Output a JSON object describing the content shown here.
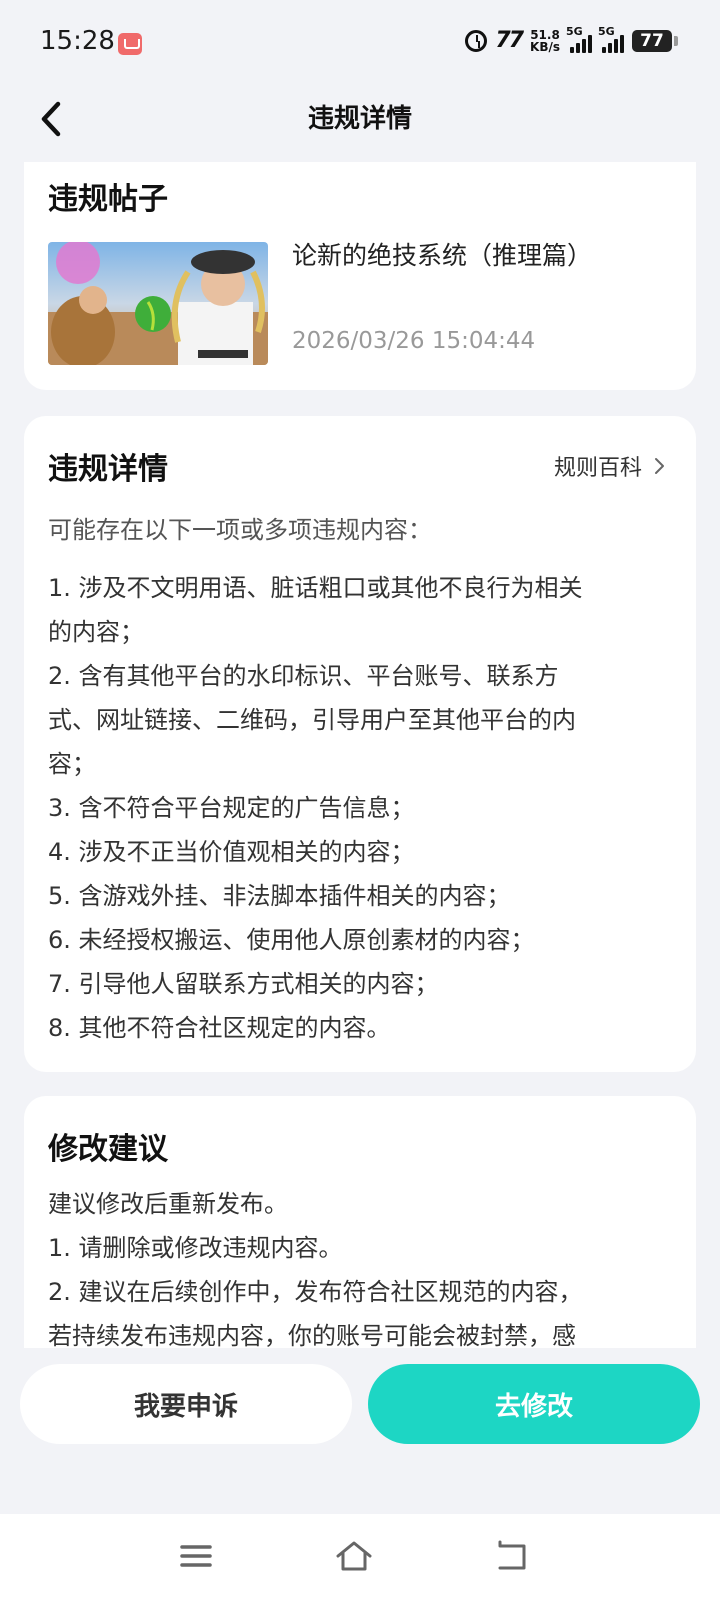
{
  "status_bar": {
    "time": "15:28",
    "net_speed_value": "51.8",
    "net_speed_unit": "KB/s",
    "signal1_label": "5G",
    "signal2_label": "5G",
    "battery": "77",
    "icons": [
      "shopping-app-icon",
      "alarm-icon",
      "nfc-icon",
      "signal-icon",
      "battery-icon"
    ]
  },
  "header": {
    "title": "违规详情"
  },
  "post_card": {
    "heading": "违规帖子",
    "post_title": "论新的绝技系统（推理篇）",
    "post_time": "2026/03/26 15:04:44"
  },
  "violation_card": {
    "heading": "违规详情",
    "rules_link": "规则百科",
    "intro": "可能存在以下一项或多项违规内容：",
    "items": [
      "1. 涉及不文明用语、脏话粗口或其他不良行为相关",
      "的内容；",
      "2. 含有其他平台的水印标识、平台账号、联系方",
      "式、网址链接、二维码，引导用户至其他平台的内",
      "容；",
      "3. 含不符合平台规定的广告信息；",
      "4. 涉及不正当价值观相关的内容；",
      "5. 含游戏外挂、非法脚本插件相关的内容；",
      "6. 未经授权搬运、使用他人原创素材的内容；",
      "7. 引导他人留联系方式相关的内容；",
      "8. 其他不符合社区规定的内容。"
    ]
  },
  "suggestion_card": {
    "heading": "修改建议",
    "lines": [
      "建议修改后重新发布。",
      "1. 请删除或修改违规内容。",
      "2. 建议在后续创作中，发布符合社区规范的内容，",
      "若持续发布违规内容，你的账号可能会被封禁，感"
    ]
  },
  "actions": {
    "appeal": "我要申诉",
    "modify": "去修改"
  },
  "colors": {
    "accent": "#1dd6c4",
    "background": "#f2f3f7"
  }
}
